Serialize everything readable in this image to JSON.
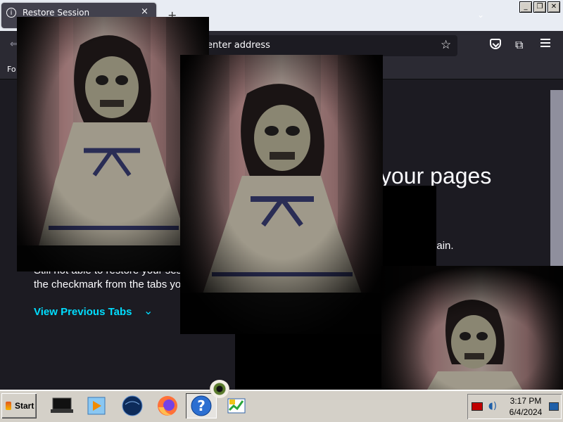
{
  "browser": {
    "tab": {
      "title": "Restore Session",
      "close_glyph": "×"
    },
    "new_tab_glyph": "+",
    "list_all_tabs_glyph": "⌄",
    "url_placeholder": "enter address",
    "bookmarks_fragment": "Fo",
    "window_controls": [
      "_",
      "❐",
      "✕"
    ]
  },
  "page": {
    "heading_fragment": "your pages",
    "try_again_fragment": "y again.",
    "still_fragment": "Still not able to restore your ses",
    "checkmark_fragment": "the checkmark from the tabs yo",
    "view_previous_tabs": "View Previous Tabs",
    "chevron_glyph": "⌄"
  },
  "overlays": {
    "description_icon": "doll-photo",
    "eyeball_icon": "eyeball-icon"
  },
  "taskbar": {
    "start_label": "Start",
    "items": [
      "laptop-icon",
      "media-player-icon",
      "globe-icon",
      "firefox-icon",
      "help-icon",
      "chart-icon"
    ],
    "clock": {
      "time": "3:17 PM",
      "date": "6/4/2024"
    }
  },
  "colors": {
    "tab_bg": "#42414d",
    "nav_bg": "#2b2a33",
    "page_bg": "#1c1b22",
    "link": "#00ddff",
    "taskbar": "#d4d0c8"
  }
}
